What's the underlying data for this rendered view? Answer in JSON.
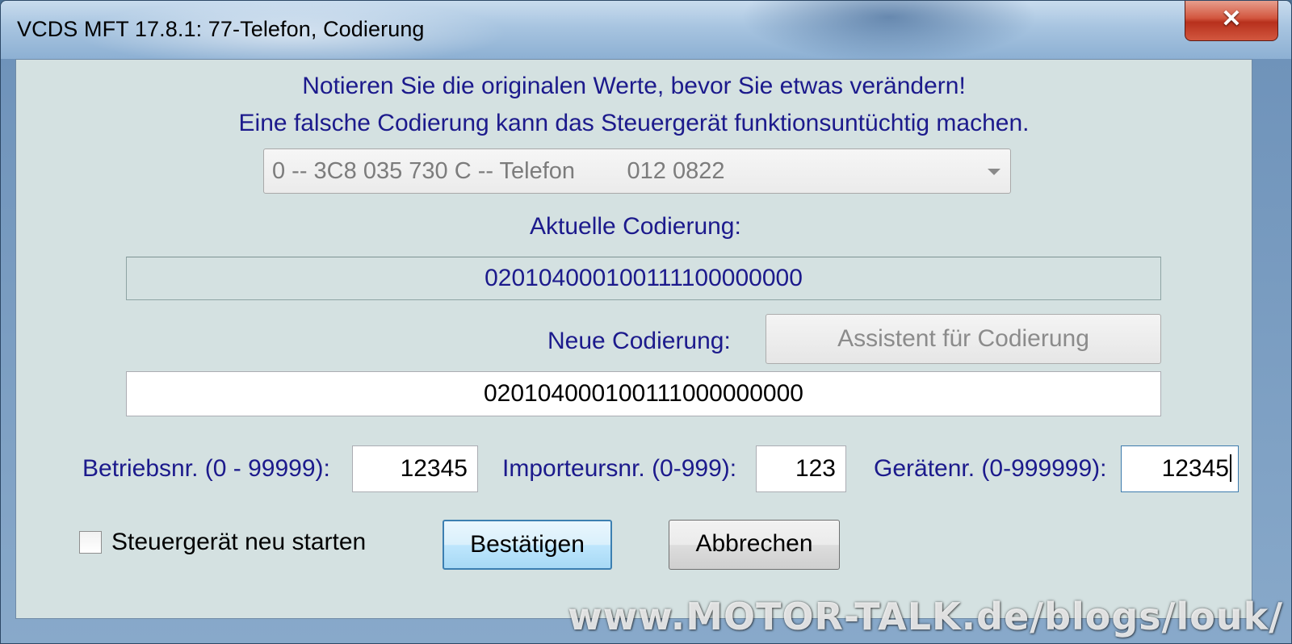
{
  "window": {
    "title": "VCDS MFT 17.8.1: 77-Telefon,  Codierung",
    "close_label": "✕"
  },
  "notice": {
    "line1": "Notieren Sie die originalen Werte, bevor Sie etwas verändern!",
    "line2": "Eine falsche Codierung kann das Steuergerät funktionsuntüchtig machen."
  },
  "module_select": {
    "value": "0 -- 3C8 035 730 C -- Telefon        012 0822"
  },
  "current_coding": {
    "label": "Aktuelle Codierung:",
    "value": "020104000100111100000000"
  },
  "new_coding": {
    "label": "Neue Codierung:",
    "value": "020104000100111000000000",
    "assistant_button": "Assistent für Codierung"
  },
  "fields": {
    "betriebsnr_label": "Betriebsnr. (0 - 99999):",
    "betriebsnr_value": "12345",
    "importeursnr_label": "Importeursnr. (0-999):",
    "importeursnr_value": "123",
    "geraetenr_label": "Gerätenr. (0-999999):",
    "geraetenr_value": "12345"
  },
  "controls": {
    "restart_label": "Steuergerät neu starten",
    "restart_checked": false,
    "confirm_button": "Bestätigen",
    "cancel_button": "Abbrechen"
  },
  "watermark": "www.MOTOR-TALK.de/blogs/louk/"
}
